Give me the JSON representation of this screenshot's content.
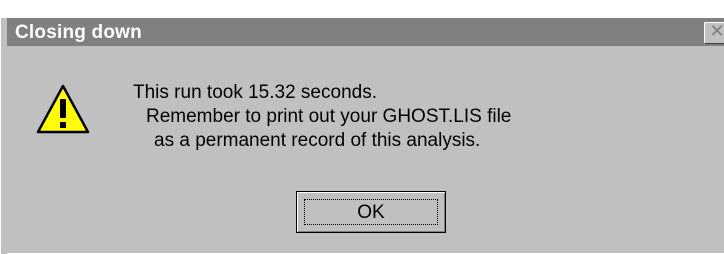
{
  "window": {
    "title": "Closing down",
    "close_label": "✕"
  },
  "message": {
    "line1": "This run took 15.32 seconds.",
    "line2": "Remember to print out your GHOST.LIS file",
    "line3": "as a permanent record of this analysis."
  },
  "buttons": {
    "ok_label": "OK"
  },
  "icon": {
    "name": "warning-icon",
    "fill": "#ffff00",
    "stroke": "#000000"
  },
  "colors": {
    "titlebar": "#808080",
    "face": "#c0c0c0"
  }
}
